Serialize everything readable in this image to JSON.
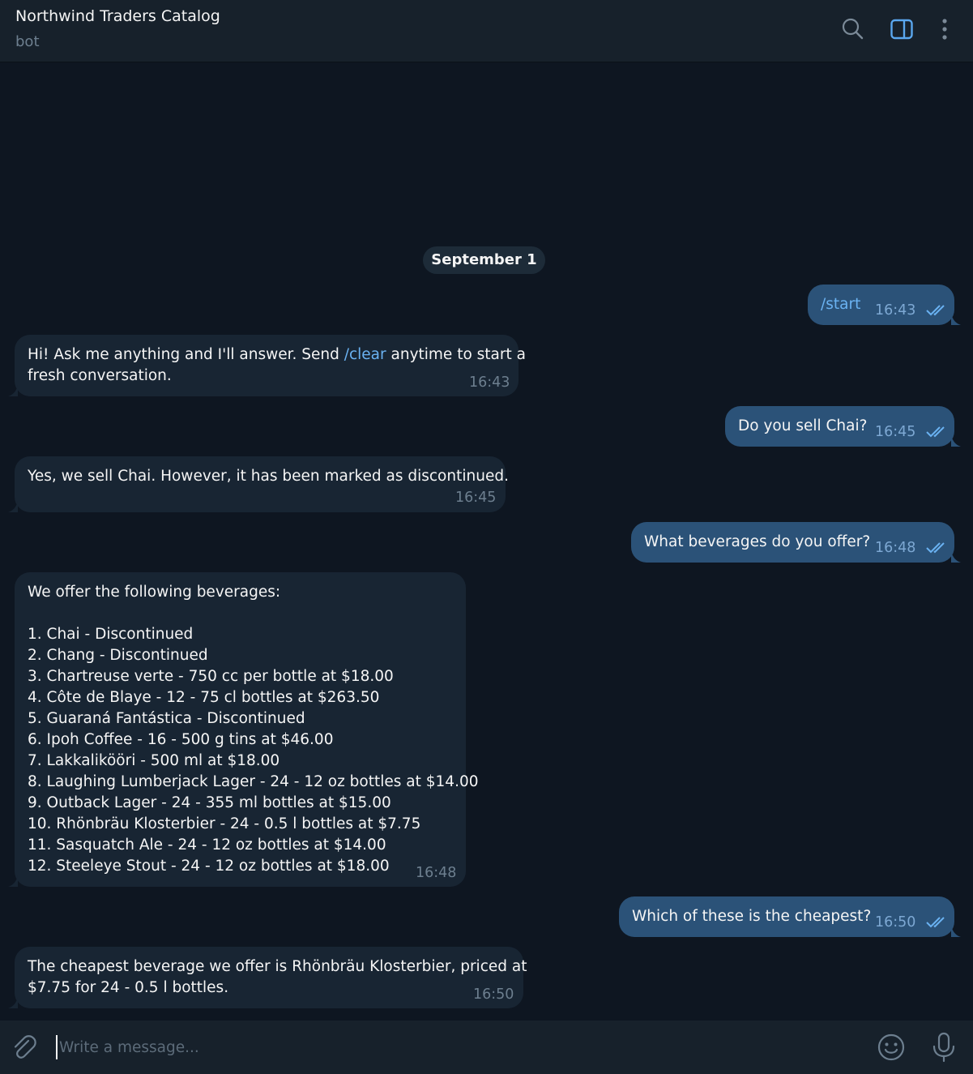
{
  "header": {
    "title": "Northwind Traders Catalog",
    "subtitle": "bot",
    "icons": [
      "search-icon",
      "sidebar-toggle-icon",
      "more-vertical-icon"
    ]
  },
  "date_separator": "September 1",
  "messages": [
    {
      "direction": "out",
      "text": "/start",
      "time": "16:43",
      "status": "read"
    },
    {
      "direction": "in",
      "text_before": "Hi! Ask me anything and I'll answer. Send ",
      "command": "/clear",
      "text_after": " anytime to start a",
      "text_line2": "fresh conversation.",
      "time": "16:43"
    },
    {
      "direction": "out",
      "text": "Do you sell Chai?",
      "time": "16:45",
      "status": "read"
    },
    {
      "direction": "in",
      "text": "Yes, we sell Chai. However, it has been marked as discontinued.",
      "time": "16:45"
    },
    {
      "direction": "out",
      "text": "What beverages do you offer?",
      "time": "16:48",
      "status": "read"
    },
    {
      "direction": "in",
      "text": "We offer the following beverages:\n\n1. Chai - Discontinued\n2. Chang - Discontinued\n3. Chartreuse verte - 750 cc per bottle at $18.00\n4. Côte de Blaye - 12 - 75 cl bottles at $263.50\n5. Guaraná Fantástica - Discontinued\n6. Ipoh Coffee - 16 - 500 g tins at $46.00\n7. Lakkalikööri - 500 ml at $18.00\n8. Laughing Lumberjack Lager - 24 - 12 oz bottles at $14.00\n9. Outback Lager - 24 - 355 ml bottles at $15.00\n10. Rhönbräu Klosterbier - 24 - 0.5 l bottles at $7.75\n11. Sasquatch Ale - 24 - 12 oz bottles at $14.00\n12. Steeleye Stout - 24 - 12 oz bottles at $18.00",
      "time": "16:48"
    },
    {
      "direction": "out",
      "text": "Which of these is the cheapest?",
      "time": "16:50",
      "status": "read"
    },
    {
      "direction": "in",
      "text": "The cheapest beverage we offer is Rhönbräu Klosterbier, priced at\n$7.75 for 24 - 0.5 l bottles.",
      "time": "16:50"
    }
  ],
  "composer": {
    "placeholder": "Write a message...",
    "icons": [
      "paperclip-icon",
      "emoji-icon",
      "microphone-icon"
    ]
  },
  "colors": {
    "background": "#0e1621",
    "panel": "#17212b",
    "incoming_bubble": "#182533",
    "outgoing_bubble": "#2b5278",
    "accent": "#6ab2f2",
    "muted": "#6d7f8f"
  }
}
